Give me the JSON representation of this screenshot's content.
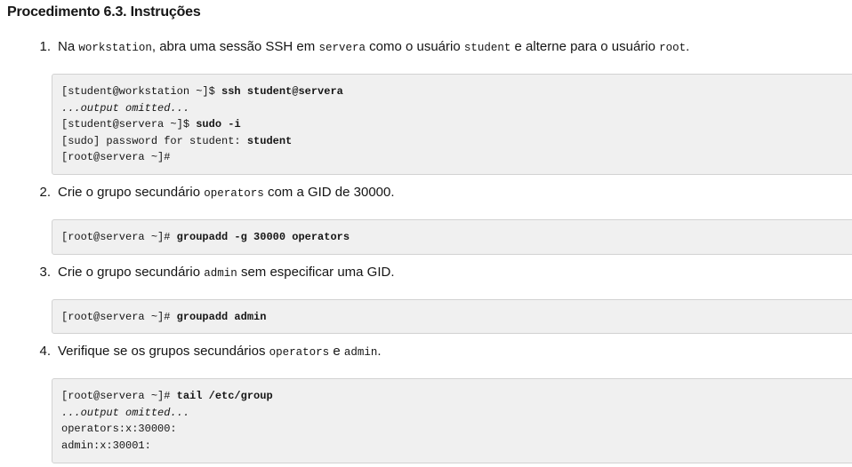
{
  "title": "Procedimento 6.3. Instruções",
  "steps": [
    {
      "num": "1.",
      "text": [
        {
          "t": "Na "
        },
        {
          "t": "workstation",
          "mono": true
        },
        {
          "t": ", abra uma sessão SSH em "
        },
        {
          "t": "servera",
          "mono": true
        },
        {
          "t": " como o usuário "
        },
        {
          "t": "student",
          "mono": true
        },
        {
          "t": " e alterne para o usuário "
        },
        {
          "t": "root",
          "mono": true
        },
        {
          "t": "."
        }
      ],
      "code": [
        [
          {
            "t": "[student@workstation ~]$ "
          },
          {
            "t": "ssh student@servera",
            "bold": true
          }
        ],
        [
          {
            "t": "...output omitted...",
            "italic": true
          }
        ],
        [
          {
            "t": "[student@servera ~]$ "
          },
          {
            "t": "sudo -i",
            "bold": true
          }
        ],
        [
          {
            "t": "[sudo] password for student: "
          },
          {
            "t": "student",
            "bold": true
          }
        ],
        [
          {
            "t": "[root@servera ~]#"
          }
        ]
      ]
    },
    {
      "num": "2.",
      "text": [
        {
          "t": "Crie o grupo secundário "
        },
        {
          "t": "operators",
          "mono": true
        },
        {
          "t": " com a GID de 30000."
        }
      ],
      "code": [
        [
          {
            "t": "[root@servera ~]# "
          },
          {
            "t": "groupadd -g 30000 operators",
            "bold": true
          }
        ]
      ]
    },
    {
      "num": "3.",
      "text": [
        {
          "t": "Crie o grupo secundário "
        },
        {
          "t": "admin",
          "mono": true
        },
        {
          "t": " sem especificar uma GID."
        }
      ],
      "code": [
        [
          {
            "t": "[root@servera ~]# "
          },
          {
            "t": "groupadd admin",
            "bold": true
          }
        ]
      ]
    },
    {
      "num": "4.",
      "text": [
        {
          "t": "Verifique se os grupos secundários "
        },
        {
          "t": "operators",
          "mono": true
        },
        {
          "t": " e "
        },
        {
          "t": "admin",
          "mono": true
        },
        {
          "t": "."
        }
      ],
      "code": [
        [
          {
            "t": "[root@servera ~]# "
          },
          {
            "t": "tail /etc/group",
            "bold": true
          }
        ],
        [
          {
            "t": "...output omitted...",
            "italic": true
          }
        ],
        [
          {
            "t": "operators:x:30000:"
          }
        ],
        [
          {
            "t": "admin:x:30001:"
          }
        ]
      ]
    }
  ]
}
